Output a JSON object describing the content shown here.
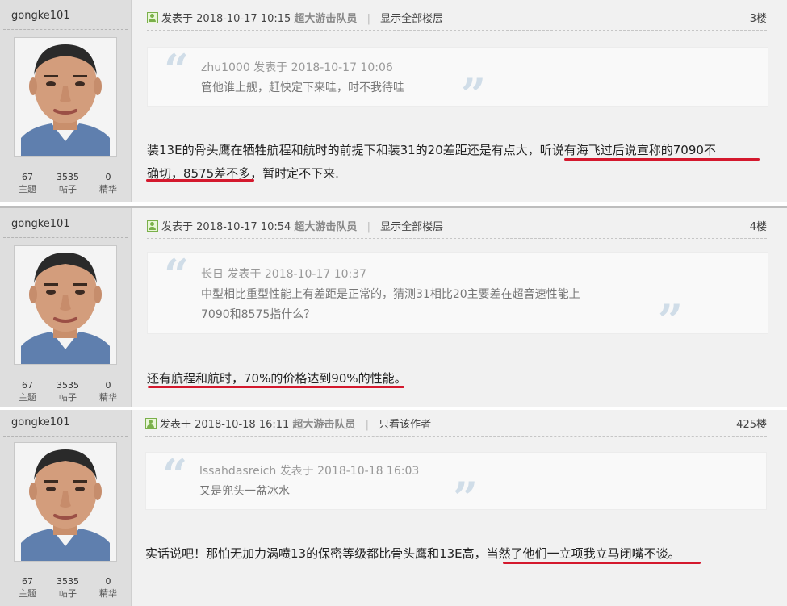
{
  "posts": [
    {
      "username": "gongke101",
      "stats": [
        {
          "value": "67",
          "label": "主题"
        },
        {
          "value": "3535",
          "label": "帖子"
        },
        {
          "value": "0",
          "label": "精华"
        }
      ],
      "posted_on": "发表于 2018-10-17 10:15",
      "group": "超大游击队员",
      "action": "显示全部楼层",
      "floor": "3楼",
      "quote_author": "zhu1000 发表于 2018-10-17 10:06",
      "quote_lines": [
        "管他谁上舰，赶快定下来哇，时不我待哇"
      ],
      "body_lines": [
        "装13E的骨头鹰在牺牲航程和航时的前提下和装31的20差距还是有点大，听说有海飞过后说宣称的7090不",
        "确切，8575差不多，暂时定不下来."
      ]
    },
    {
      "username": "gongke101",
      "stats": [
        {
          "value": "67",
          "label": "主题"
        },
        {
          "value": "3535",
          "label": "帖子"
        },
        {
          "value": "0",
          "label": "精华"
        }
      ],
      "posted_on": "发表于 2018-10-17 10:54",
      "group": "超大游击队员",
      "action": "显示全部楼层",
      "floor": "4楼",
      "quote_author": "长日 发表于 2018-10-17 10:37",
      "quote_lines": [
        "中型相比重型性能上有差距是正常的，猜测31相比20主要差在超音速性能上",
        "7090和8575指什么？"
      ],
      "body_lines": [
        "还有航程和航时，70%的价格达到90%的性能。"
      ]
    },
    {
      "username": "gongke101",
      "stats": [
        {
          "value": "67",
          "label": "主题"
        },
        {
          "value": "3535",
          "label": "帖子"
        },
        {
          "value": "0",
          "label": "精华"
        }
      ],
      "posted_on": "发表于 2018-10-18 16:11",
      "group": "超大游击队员",
      "action": "只看该作者",
      "floor": "425楼",
      "quote_author": "lssahdasreich 发表于 2018-10-18 16:03",
      "quote_lines": [
        "又是兜头一盆冰水"
      ],
      "body_lines": [
        "实话说吧！那怕无加力涡喷13的保密等级都比骨头鹰和13E高，当然了他们一立项我立马闭嘴不谈。"
      ]
    }
  ],
  "colors": {
    "highlight_underline": "#d4182d",
    "quote_mark": "#d0dde8",
    "sidebar_bg": "#dedede",
    "post_bg": "#f1f1f1"
  }
}
